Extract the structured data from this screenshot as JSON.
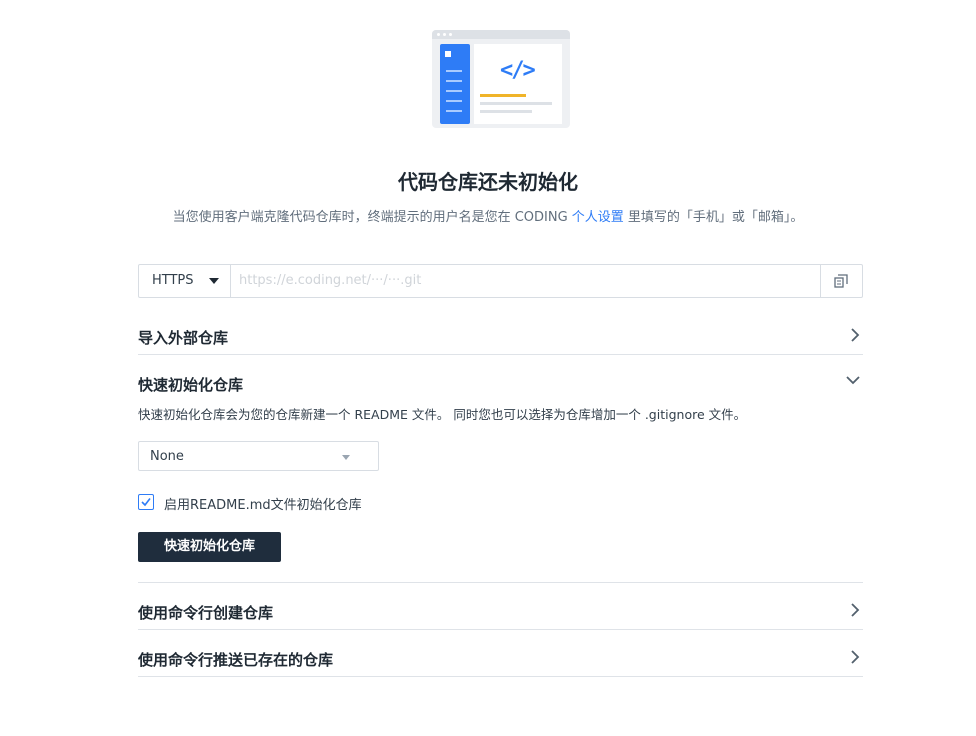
{
  "empty_state": {
    "title": "代码仓库还未初始化",
    "subtitle_before": "当您使用客户端克隆代码仓库时，终端提示的用户名是您在 CODING ",
    "subtitle_link": "个人设置",
    "subtitle_after": " 里填写的「手机」或「邮箱」。",
    "illustration_code": "</>"
  },
  "clone": {
    "protocol": "HTTPS",
    "url": "https://e.coding.net/···/···.git",
    "copy_icon": "copy-icon"
  },
  "sections": {
    "import": {
      "label": "导入外部仓库",
      "icon": "chevron-right-icon"
    },
    "quick_init": {
      "label": "快速初始化仓库",
      "icon": "chevron-down-icon",
      "description": "快速初始化仓库会为您的仓库新建一个 README 文件。 同时您也可以选择为仓库增加一个 .gitignore 文件。",
      "gitignore_select": "None",
      "readme_checkbox_label": "启用README.md文件初始化仓库",
      "readme_checked": true,
      "button": "快速初始化仓库"
    },
    "create_cli": {
      "label": "使用命令行创建仓库",
      "icon": "chevron-right-icon"
    },
    "push_cli": {
      "label": "使用命令行推送已存在的仓库",
      "icon": "chevron-right-icon"
    }
  },
  "colors": {
    "accent": "#2e7cf6",
    "primary_button": "#1f2d3d",
    "illustration_bar": "#f0b429"
  }
}
